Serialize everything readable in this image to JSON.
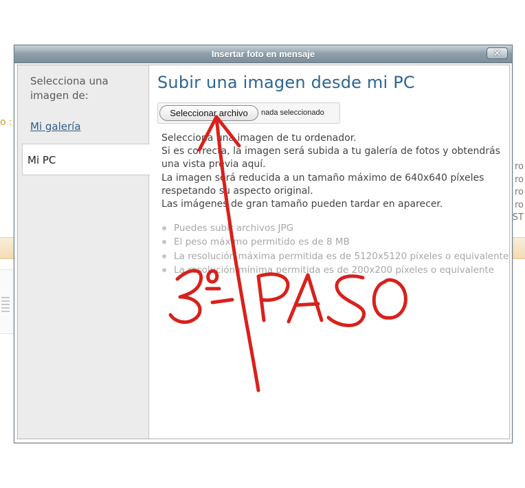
{
  "background": {
    "left_fragment": "o :",
    "right_fragments": [
      "ro",
      "ro",
      "ro",
      "ro",
      "ST"
    ]
  },
  "dialog": {
    "title": "Insertar foto en mensaje",
    "close_label": "✕"
  },
  "sidebar": {
    "heading": "Selecciona una imagen de:",
    "items": [
      {
        "label": "Mi galería",
        "state": "link"
      },
      {
        "label": "Mi PC",
        "state": "selected"
      }
    ]
  },
  "main": {
    "title": "Subir una imagen desde mi PC",
    "file_input": {
      "button_label": "Seleccionar archivo",
      "status": "nada seleccionado"
    },
    "description": [
      "Selecciona una imagen de tu ordenador.",
      "Si es correcta, la imagen será subida a tu galería de fotos y obtendrás",
      "una vista previa aquí.",
      "La imagen será reducida a un tamaño máximo de 640x640 píxeles",
      "respetando su aspecto original.",
      "Las imágenes de gran tamaño pueden tardar en aparecer."
    ],
    "rules": [
      "Puedes subir archivos JPG",
      "El peso máximo permitido es de 8 MB",
      "La resolución máxima permitida es de 5120x5120 píxeles o equivalente",
      "La resolución mínima permitida es de 200x200 píxeles o equivalente"
    ]
  },
  "annotation": {
    "text": "3º- PASO",
    "color": "#d8211c"
  },
  "colors": {
    "title_blue": "#2d6593",
    "link_blue": "#2f5c88",
    "titlebar": "#8d9ea9"
  }
}
